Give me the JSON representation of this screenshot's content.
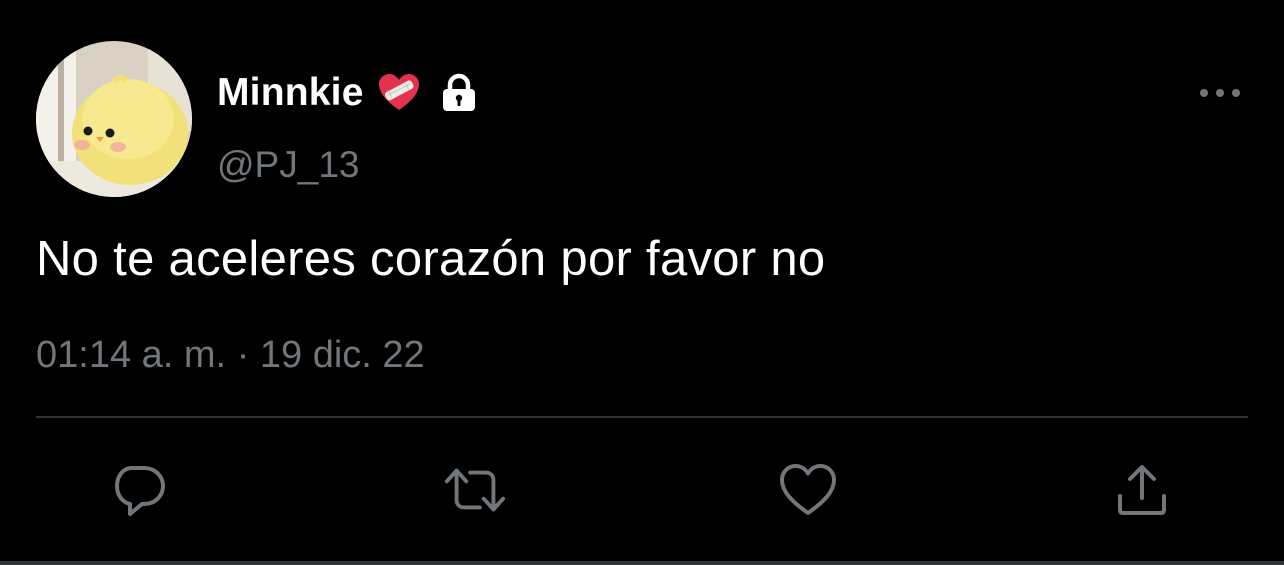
{
  "user": {
    "display_name": "Minnkie",
    "name_emoji_icon": "mending-heart-icon",
    "protected_icon": "lock-icon",
    "handle": "@PJ_13",
    "avatar": "yellow-chick-plush-avatar"
  },
  "tweet": {
    "text": "No te aceleres corazón por favor no",
    "time": "01:14 a. m.",
    "separator": "·",
    "date": "19 dic. 22"
  },
  "actions": [
    {
      "name": "reply",
      "icon": "speech-bubble-icon"
    },
    {
      "name": "retweet",
      "icon": "retweet-arrows-icon"
    },
    {
      "name": "like",
      "icon": "heart-outline-icon"
    },
    {
      "name": "share",
      "icon": "share-upload-icon"
    }
  ],
  "menu": {
    "icon": "more-dots-icon"
  },
  "colors": {
    "background": "#000000",
    "primary_text": "#ffffff",
    "secondary_text": "#71767b",
    "divider": "#2f3336",
    "heart_red": "#e0334f"
  }
}
